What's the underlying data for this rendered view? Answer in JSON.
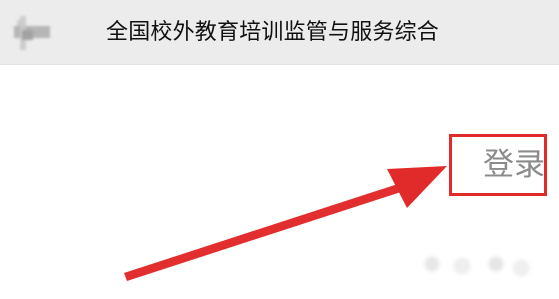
{
  "header": {
    "title": "全国校外教育培训监管与服务综合"
  },
  "main": {
    "login_label": "登录"
  },
  "colors": {
    "top_bar": "#ececec",
    "title_text": "#111111",
    "login_text": "#8b8b8b",
    "annotation": "#e12a2a"
  }
}
